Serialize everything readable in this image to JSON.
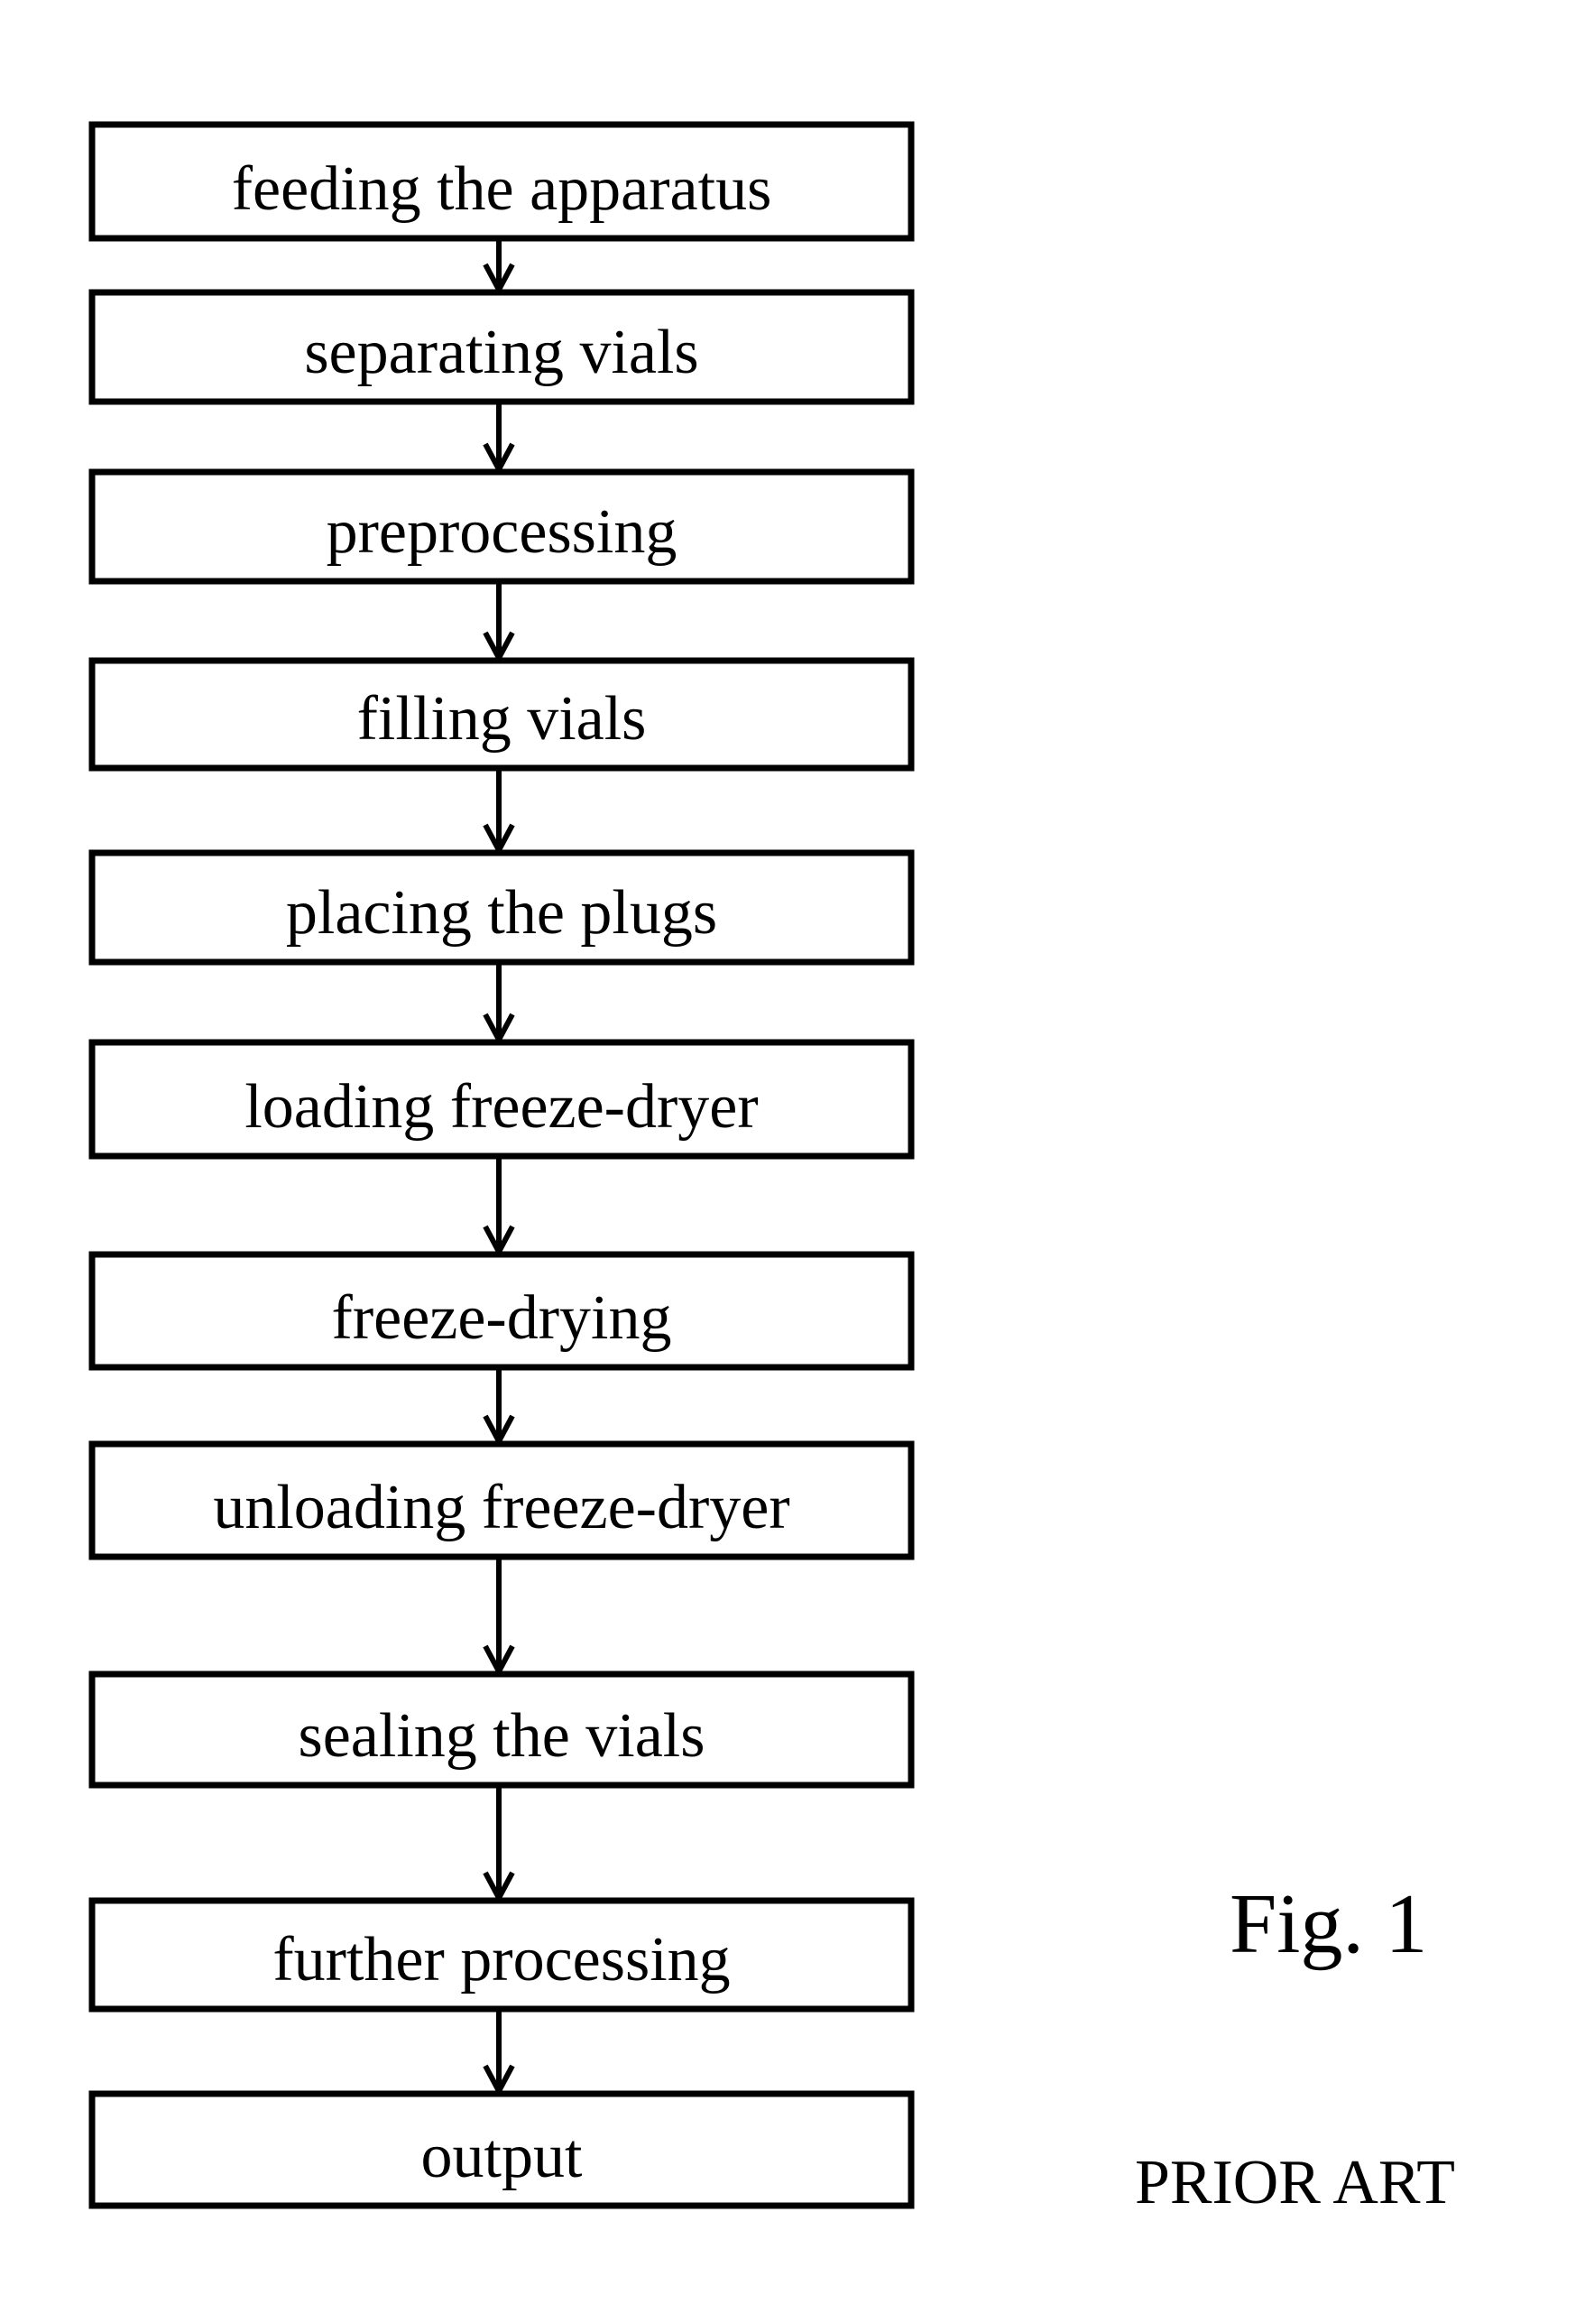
{
  "figure": {
    "label": "Fig. 1",
    "note": "PRIOR ART"
  },
  "flowchart": {
    "steps": [
      {
        "label": "feeding the apparatus"
      },
      {
        "label": "separating vials"
      },
      {
        "label": "preprocessing"
      },
      {
        "label": "filling vials"
      },
      {
        "label": "placing the plugs"
      },
      {
        "label": "loading freeze-dryer"
      },
      {
        "label": "freeze-drying"
      },
      {
        "label": "unloading freeze-dryer"
      },
      {
        "label": "sealing the vials"
      },
      {
        "label": "further processing"
      },
      {
        "label": "output"
      }
    ],
    "connections": [
      {
        "from": 0,
        "to": 1,
        "icon": "arrow-down-icon"
      },
      {
        "from": 1,
        "to": 2,
        "icon": "arrow-down-icon"
      },
      {
        "from": 2,
        "to": 3,
        "icon": "arrow-down-icon"
      },
      {
        "from": 3,
        "to": 4,
        "icon": "arrow-down-icon"
      },
      {
        "from": 4,
        "to": 5,
        "icon": "arrow-down-icon"
      },
      {
        "from": 5,
        "to": 6,
        "icon": "arrow-down-icon"
      },
      {
        "from": 6,
        "to": 7,
        "icon": "arrow-down-icon"
      },
      {
        "from": 7,
        "to": 8,
        "icon": "arrow-down-icon"
      },
      {
        "from": 8,
        "to": 9,
        "icon": "arrow-down-icon"
      },
      {
        "from": 9,
        "to": 10,
        "icon": "arrow-down-icon"
      }
    ]
  }
}
